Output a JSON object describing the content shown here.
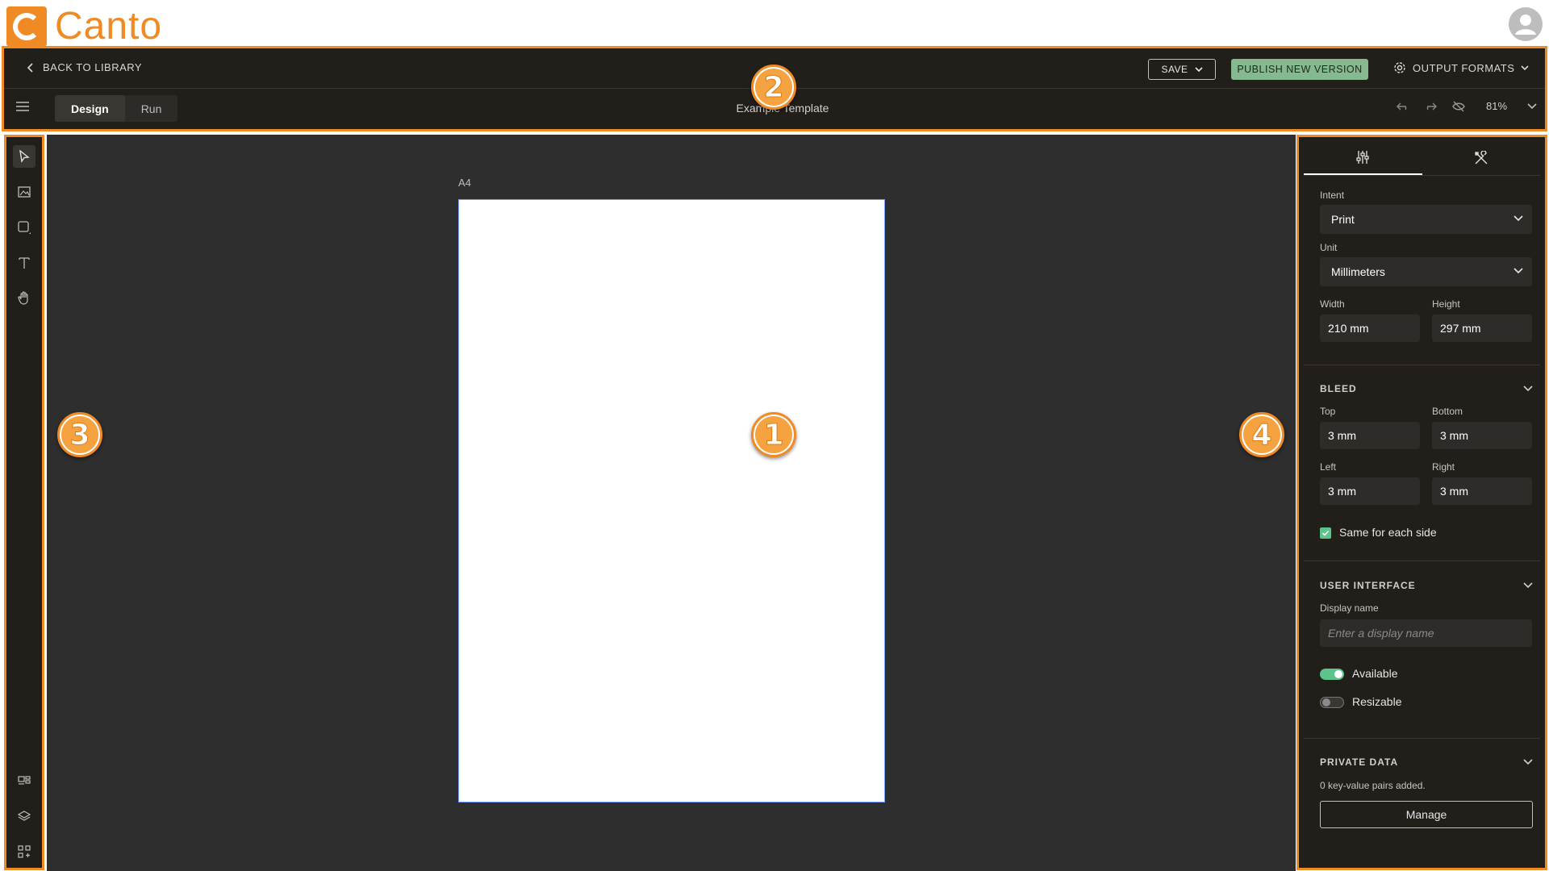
{
  "brand": {
    "name": "Canto",
    "color": "#f08a24"
  },
  "header": {
    "back_label": "BACK TO LIBRARY",
    "save_label": "SAVE",
    "publish_label": "PUBLISH NEW VERSION",
    "output_formats_label": "OUTPUT FORMATS",
    "tabs": [
      {
        "label": "Design",
        "active": true
      },
      {
        "label": "Run",
        "active": false
      }
    ],
    "document_title": "Example Template",
    "zoom": "81%"
  },
  "canvas": {
    "page_label": "A4"
  },
  "callouts": [
    "1",
    "2",
    "3",
    "4"
  ],
  "toolbar": {
    "tools": [
      "select-icon",
      "image-icon",
      "shape-icon",
      "text-icon",
      "hand-icon"
    ],
    "bottom_tools": [
      "layout-icon",
      "layers-icon",
      "components-icon"
    ]
  },
  "properties": {
    "intent_label": "Intent",
    "intent_value": "Print",
    "unit_label": "Unit",
    "unit_value": "Millimeters",
    "width_label": "Width",
    "width_value": "210 mm",
    "height_label": "Height",
    "height_value": "297 mm",
    "bleed": {
      "title": "BLEED",
      "top_label": "Top",
      "top_value": "3 mm",
      "bottom_label": "Bottom",
      "bottom_value": "3 mm",
      "left_label": "Left",
      "left_value": "3 mm",
      "right_label": "Right",
      "right_value": "3 mm",
      "same_label": "Same for each side"
    },
    "user_interface": {
      "title": "USER INTERFACE",
      "display_name_label": "Display name",
      "display_name_placeholder": "Enter a display name",
      "available_label": "Available",
      "resizable_label": "Resizable"
    },
    "private_data": {
      "title": "PRIVATE DATA",
      "count_text": "0 key-value pairs added.",
      "manage_label": "Manage"
    }
  }
}
